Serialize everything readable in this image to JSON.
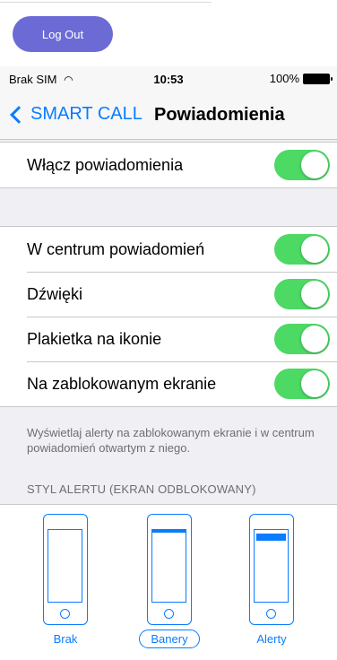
{
  "app": {
    "logout_label": "Log Out"
  },
  "statusbar": {
    "carrier": "Brak SIM",
    "time": "10:53",
    "battery": "100%"
  },
  "navbar": {
    "back_label": "SMART CALL",
    "title": "Powiadomienia"
  },
  "settings": {
    "main_toggle": {
      "label": "Włącz powiadomienia",
      "on": true
    },
    "items": [
      {
        "label": "W centrum powiadomień",
        "on": true
      },
      {
        "label": "Dźwięki",
        "on": true
      },
      {
        "label": "Plakietka na ikonie",
        "on": true
      },
      {
        "label": "Na zablokowanym ekranie",
        "on": true
      }
    ],
    "footer_note": "Wyświetlaj alerty na zablokowanym ekranie i w centrum powiadomień otwartym z niego.",
    "alert_style_header": "STYL ALERTU (EKRAN ODBLOKOWANY)"
  },
  "alert_styles": {
    "selected": "Banery",
    "options": [
      {
        "label": "Brak"
      },
      {
        "label": "Banery"
      },
      {
        "label": "Alerty"
      }
    ]
  },
  "colors": {
    "accent": "#0a7cff",
    "toggle_on": "#4cd964",
    "logout_button": "#6c6bd6"
  }
}
